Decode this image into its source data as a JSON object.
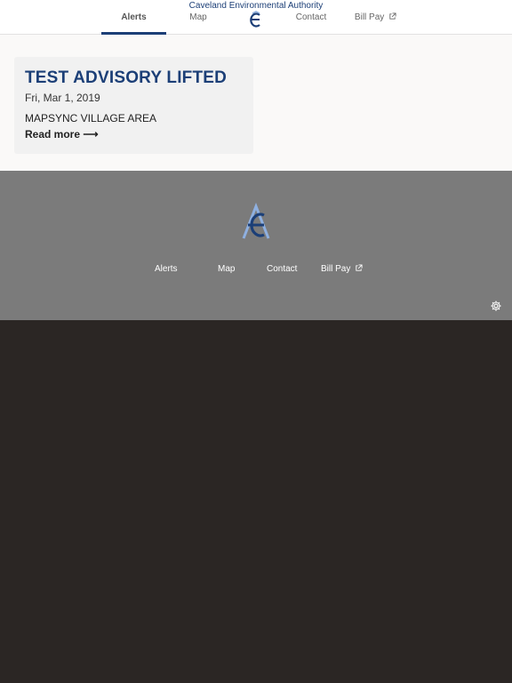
{
  "header": {
    "site_title": "Caveland Environmental Authority",
    "nav": {
      "alerts": "Alerts",
      "map": "Map",
      "contact": "Contact",
      "bill_pay": "Bill Pay"
    }
  },
  "alert_card": {
    "title": "TEST ADVISORY LIFTED",
    "date": "Fri, Mar 1, 2019",
    "area": "MAPSYNC VILLAGE AREA",
    "read_more": "Read more ⟶"
  },
  "footer": {
    "links": {
      "alerts": "Alerts",
      "map": "Map",
      "contact": "Contact",
      "bill_pay": "Bill Pay"
    }
  },
  "colors": {
    "brand": "#1c3f77",
    "footer_bg": "#7b7b7b",
    "page_bg": "#2b2624"
  },
  "icons": [
    "logo-icon",
    "external-link-icon",
    "gear-icon"
  ]
}
